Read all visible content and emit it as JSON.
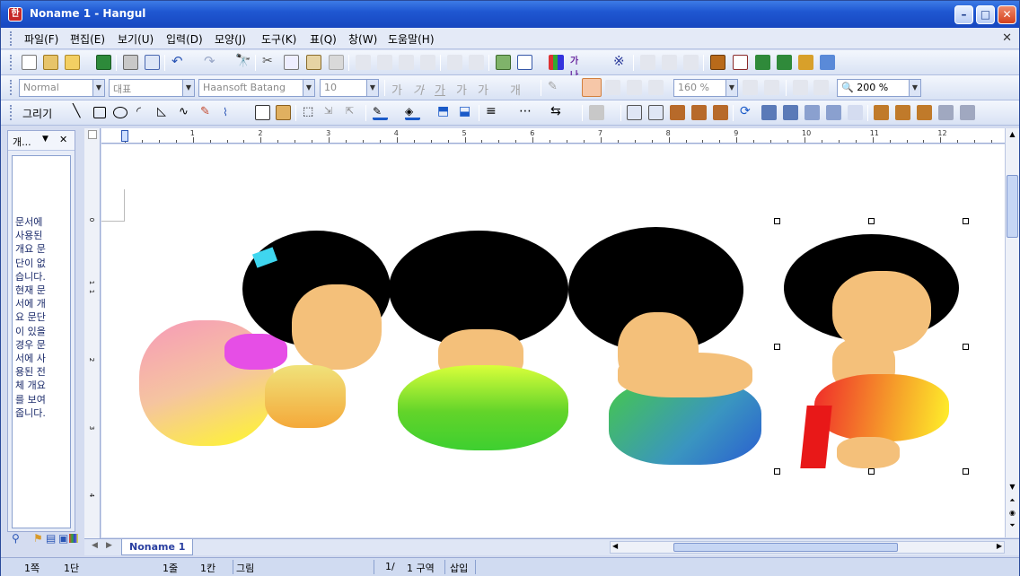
{
  "window": {
    "title": "Noname 1 - Hangul",
    "app_icon": "한"
  },
  "menu": [
    "파일(F)",
    "편집(E)",
    "보기(U)",
    "입력(D)",
    "모양(J)",
    "도구(K)",
    "표(Q)",
    "창(W)",
    "도움말(H)"
  ],
  "format_toolbar": {
    "style": "Normal",
    "font_lang": "대표",
    "font": "Haansoft Batang",
    "font_size": "10",
    "line_spacing": "160 %",
    "zoom": "200 %",
    "char_buttons": [
      "가",
      "가",
      "가",
      "가",
      "가",
      "개"
    ]
  },
  "draw_toolbar": {
    "label": "그리기"
  },
  "outline_panel": {
    "title": "개...",
    "message": "문서에\n사용된\n개요 문\n단이 없\n습니다.\n현재 문\n서에 개\n요 문단\n이 있을\n경우 문\n서에 사\n용된 전\n체 개요\n를 보여\n줍니다."
  },
  "ruler": {
    "h_labels": [
      "1",
      "2",
      "3",
      "4",
      "5",
      "6",
      "7",
      "8",
      "9",
      "10",
      "11",
      "12"
    ],
    "v_labels": [
      "1",
      "0",
      "1",
      "2",
      "3",
      "4"
    ]
  },
  "document_tab": "Noname 1",
  "status": {
    "page": "1쪽",
    "section": "1단",
    "line": "1줄",
    "column": "1칸",
    "object": "그림",
    "page_count": "1/",
    "section_info": "1 구역",
    "mode": "삽입"
  },
  "colors": {
    "titlebar": "#1f57d2",
    "selected_align": "#f6c7a8"
  }
}
